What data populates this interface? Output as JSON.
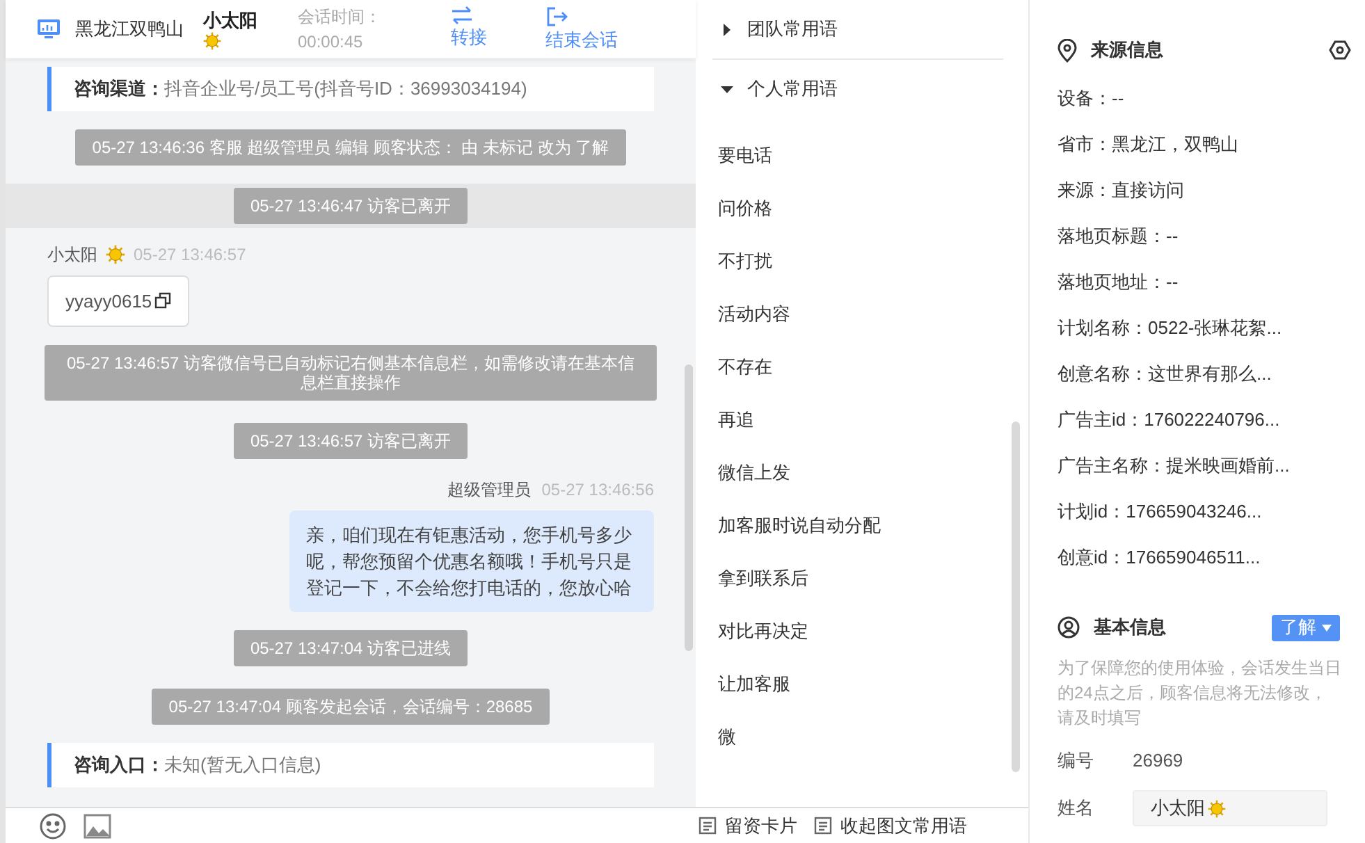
{
  "header": {
    "location": "黑龙江双鸭山",
    "visitor": "小太阳",
    "session_label": "会话时间：",
    "session_time": "00:00:45",
    "actions": [
      {
        "label": "转接",
        "kind": "transfer"
      },
      {
        "label": "结束会话",
        "kind": "end"
      }
    ]
  },
  "messages": [
    {
      "kind": "card",
      "label": "咨询渠道：",
      "value": "抖音企业号/员工号(抖音号ID：36993034194)"
    },
    {
      "kind": "system",
      "text": "05-27 13:46:36 客服 超级管理员 编辑 顾客状态： 由 未标记 改为 了解",
      "highlighted": false
    },
    {
      "kind": "system",
      "text": "05-27 13:46:47 访客已离开",
      "highlighted": true
    },
    {
      "kind": "visitor",
      "name": "小太阳",
      "time": "05-27 13:46:57",
      "text": "yyayy0615"
    },
    {
      "kind": "system",
      "text": "05-27 13:46:57 访客微信号已自动标记右侧基本信息栏，如需修改请在基本信息栏直接操作",
      "highlighted": false
    },
    {
      "kind": "system",
      "text": "05-27 13:46:57 访客已离开",
      "highlighted": false
    },
    {
      "kind": "agent",
      "name": "超级管理员",
      "time": "05-27 13:46:56",
      "text": "亲，咱们现在有钜惠活动，您手机号多少呢，帮您预留个优惠名额哦！手机号只是登记一下，不会给您打电话的，您放心哈"
    },
    {
      "kind": "system",
      "text": "05-27 13:47:04 访客已进线",
      "highlighted": false
    },
    {
      "kind": "system",
      "text": "05-27 13:47:04 顾客发起会话，会话编号：28685",
      "highlighted": false
    },
    {
      "kind": "card",
      "label": "咨询入口：",
      "value": "未知(暂无入口信息)"
    }
  ],
  "phrase_groups": [
    {
      "label": "团队常用语",
      "expanded": false
    },
    {
      "label": "个人常用语",
      "expanded": true,
      "children": [
        "要电话",
        "问价格",
        "不打扰",
        "活动内容",
        "不存在",
        "再追",
        "微信上发",
        "加客服时说自动分配",
        "拿到联系后",
        "对比再决定",
        "让加客服",
        "微"
      ]
    }
  ],
  "phrase_footer": [
    "留资卡片",
    "收起图文常用语"
  ],
  "source_info": {
    "title": "来源信息",
    "rows": [
      "设备：--",
      "省市：黑龙江，双鸭山",
      "来源：直接访问",
      "落地页标题：--",
      "落地页地址：--",
      "计划名称：0522-张琳花絮...",
      "创意名称：这世界有那么...",
      "广告主id：176022240796...",
      "广告主名称：提米映画婚前...",
      "计划id：176659043246...",
      "创意id：176659046511..."
    ]
  },
  "basic_info": {
    "title": "基本信息",
    "status": "了解",
    "note": "为了保障您的使用体验，会话发生当日的24点之后，顾客信息将无法修改，请及时填写",
    "fields": [
      {
        "kind": "text",
        "label": "编号",
        "value": "26969"
      },
      {
        "kind": "input",
        "label": "姓名",
        "value": "小太阳"
      }
    ]
  }
}
